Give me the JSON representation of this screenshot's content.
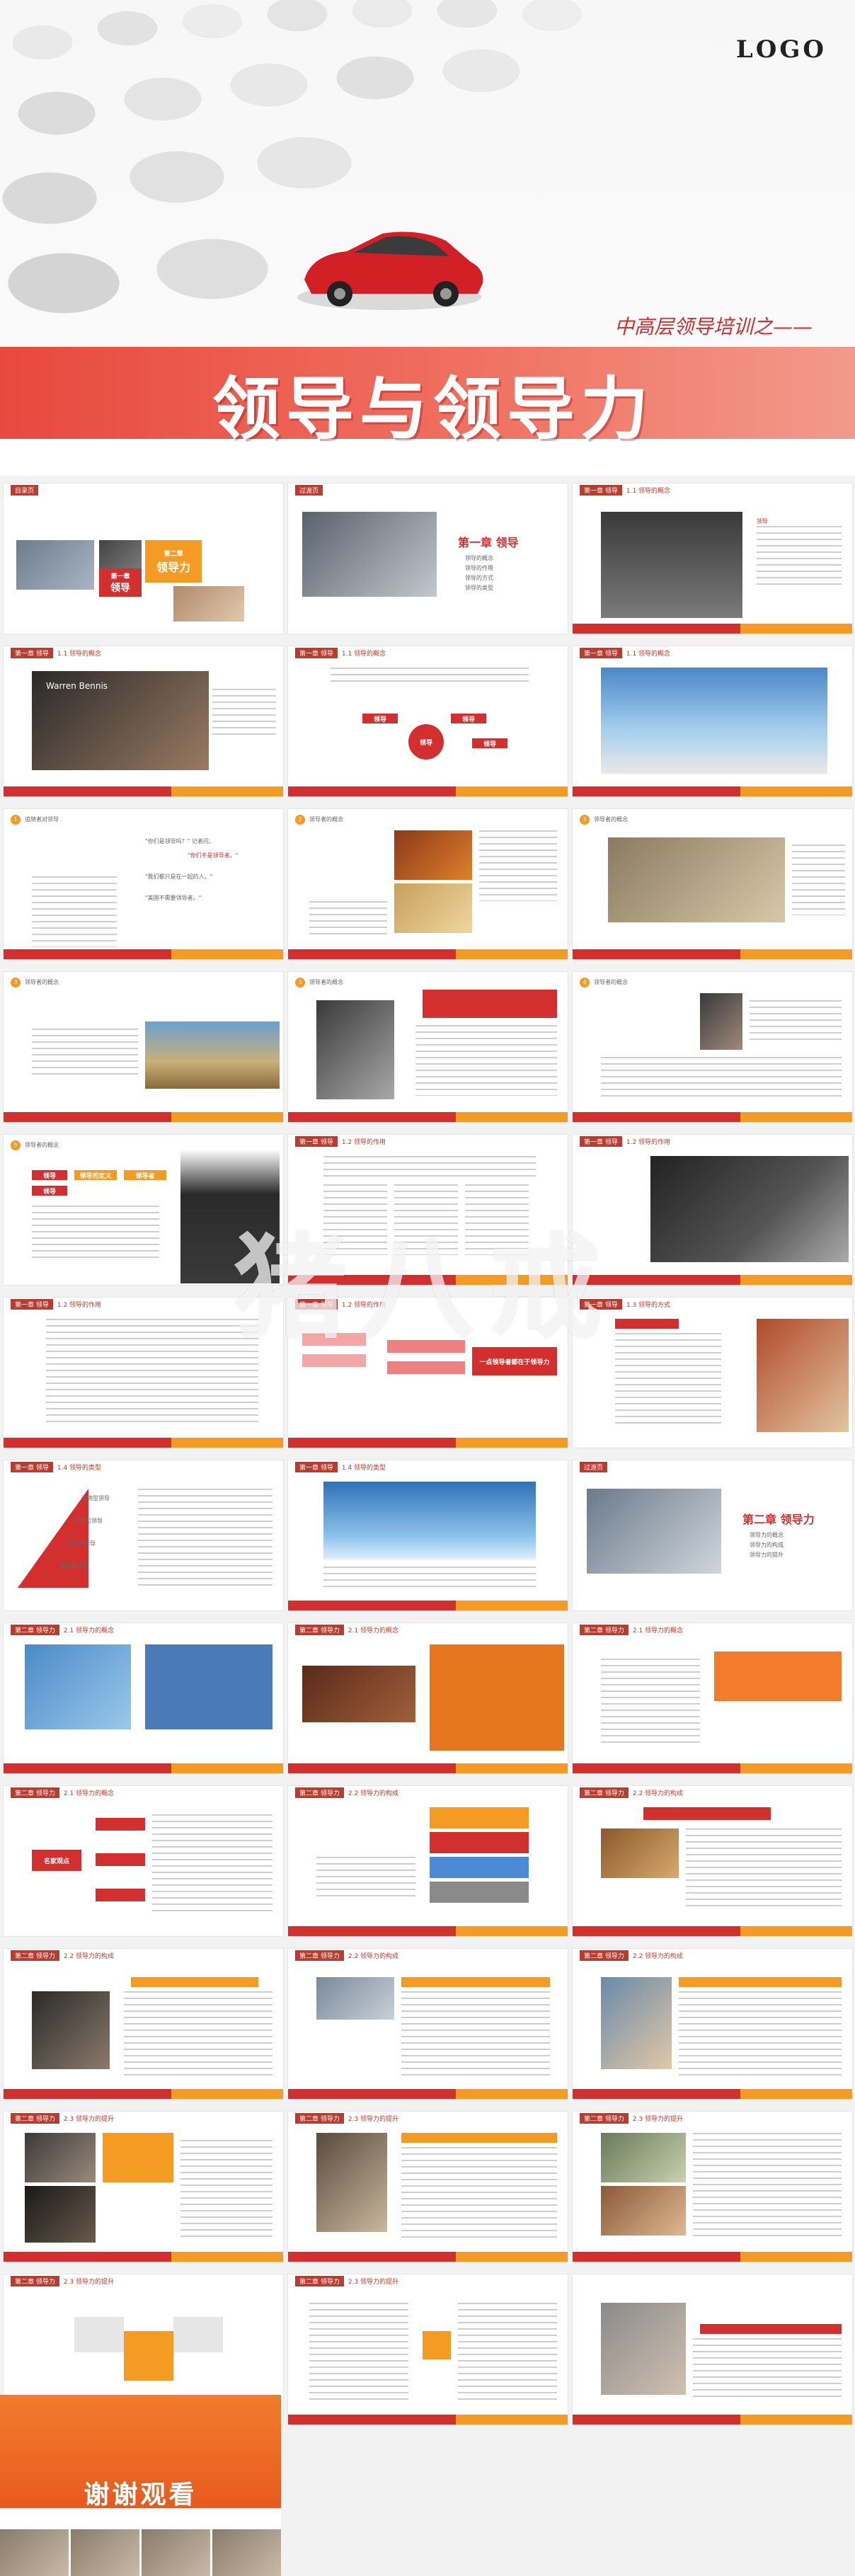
{
  "cover": {
    "logo": "LOGO",
    "course": "中高层领导培训之——",
    "title": "领导与领导力"
  },
  "slides": {
    "s1": {
      "header": "目录页",
      "small_1": "第一章",
      "big_1": "领导",
      "small_2": "第二章",
      "big_2": "领导力"
    },
    "s2": {
      "header": "过渡页",
      "chapter": "第一章  领导",
      "items": [
        "领导的概念",
        "领导的作用",
        "领导的方式",
        "领导的类型"
      ]
    },
    "s3": {
      "tag": "第一章 领导",
      "sub": "1.1 领导的概念",
      "quote_mark": "领导"
    },
    "s4": {
      "tag": "第一章 领导",
      "sub": "1.1 领导的概念",
      "caption": "Warren Bennis"
    },
    "s5": {
      "tag": "第一章 领导",
      "sub": "1.1 领导的概念",
      "badge": "领导",
      "b1": "领导",
      "b2": "领导",
      "b3": "领导"
    },
    "s6": {
      "tag": "第一章 领导",
      "sub": "1.1 领导的概念"
    },
    "s7": {
      "num": "1",
      "head": "追随者对领导",
      "q1": "\"你们是领导吗？\" 记者问。",
      "q2": "\"你们不是领导者。\"",
      "q3": "\"我们都只是在一起的人。\"",
      "q4": "\"美国不需要领导者。\""
    },
    "s8": {
      "num": "2",
      "head": "领导者的概念"
    },
    "s9": {
      "num": "3",
      "head": "领导者的概念"
    },
    "s10": {
      "num": "3",
      "head": "领导者的概念"
    },
    "s11": {
      "num": "3",
      "head": "领导者的概念"
    },
    "s12": {
      "num": "4",
      "head": "领导者的概念"
    },
    "s13": {
      "num": "5",
      "head": "领导者的概念",
      "row1": [
        "领导",
        "领导的定义",
        "领导者"
      ],
      "row2": [
        "领导"
      ]
    },
    "s14": {
      "tag": "第一章 领导",
      "sub": "1.2 领导的作用"
    },
    "s15": {
      "tag": "第一章 领导",
      "sub": "1.2 领导的作用"
    },
    "s16": {
      "tag": "第一章 领导",
      "sub": "1.2 领导的作用"
    },
    "s17": {
      "tag": "第一章 领导",
      "sub": "1.2 领导的作用",
      "box": "一点领导者都在于领导力"
    },
    "s18": {
      "tag": "第一章 领导",
      "sub": "1.3 领导的方式"
    },
    "s19": {
      "tag": "第一章 领导",
      "sub": "1.4 领导的类型",
      "levels": [
        "追随型领导",
        "培养型领导",
        "授权型领导",
        "指挥型领导"
      ]
    },
    "s20": {
      "tag": "第一章 领导",
      "sub": "1.4 领导的类型"
    },
    "s21": {
      "header": "过渡页",
      "chapter": "第二章  领导力",
      "items": [
        "领导力的概念",
        "领导力的构成",
        "领导力的提升"
      ]
    },
    "s22": {
      "tag": "第二章 领导力",
      "sub": "2.1 领导力的概念"
    },
    "s23": {
      "tag": "第二章 领导力",
      "sub": "2.1 领导力的概念"
    },
    "s24": {
      "tag": "第二章 领导力",
      "sub": "2.1 领导力的概念"
    },
    "s25": {
      "tag": "第二章 领导力",
      "sub": "2.1 领导力的概念",
      "center": "名家观点"
    },
    "s26": {
      "tag": "第二章 领导力",
      "sub": "2.2 领导力的构成"
    },
    "s27": {
      "tag": "第二章 领导力",
      "sub": "2.2 领导力的构成"
    },
    "s28": {
      "tag": "第二章 领导力",
      "sub": "2.2 领导力的构成"
    },
    "s29": {
      "tag": "第二章 领导力",
      "sub": "2.2 领导力的构成"
    },
    "s30": {
      "tag": "第二章 领导力",
      "sub": "2.2 领导力的构成"
    },
    "s31": {
      "tag": "第二章 领导力",
      "sub": "2.3 领导力的提升"
    },
    "s32": {
      "tag": "第二章 领导力",
      "sub": "2.3 领导力的提升"
    },
    "s33": {
      "tag": "第二章 领导力",
      "sub": "2.3 领导力的提升"
    },
    "s34": {
      "tag": "第二章 领导力",
      "sub": "2.3 领导力的提升"
    },
    "s35": {
      "tag": "第二章 领导力",
      "sub": "2.3 领导力的提升"
    }
  },
  "footer_label": "第二章 领导力",
  "watermark": "猪八戒",
  "final": {
    "thanks": "谢谢观看"
  },
  "colors": {
    "red": "#d32f2f",
    "orange": "#f59a23"
  }
}
